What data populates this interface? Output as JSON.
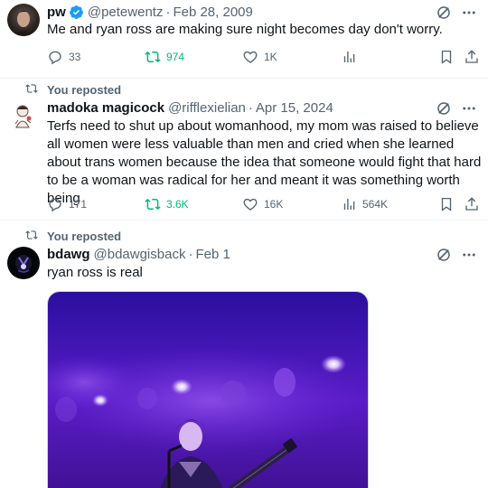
{
  "tweets": [
    {
      "name": "pw",
      "handle": "@petewentz",
      "date": "Feb 28, 2009",
      "verified": true,
      "text": "Me and ryan ross are making sure night becomes day don't worry.",
      "replies": "33",
      "reposts": "974",
      "likes": "1K",
      "views": ""
    },
    {
      "repost_label": "You reposted",
      "name": "madoka magicock",
      "handle": "@rifflexielian",
      "date": "Apr 15, 2024",
      "text": "Terfs need to shut up about womanhood, my mom was raised to believe all women were less valuable than men and cried when she learned about trans women because the idea that someone would fight that hard to be a woman was radical for her and meant it was something worth being",
      "replies": "171",
      "reposts": "3.6K",
      "likes": "16K",
      "views": "564K"
    },
    {
      "repost_label": "You reposted",
      "name": "bdawg",
      "handle": "@bdawgisback",
      "date": "Feb 1",
      "text": "ryan ross is real"
    }
  ],
  "separator": "·",
  "colors": {
    "text": "#0f1419",
    "muted": "#536471",
    "verified": "#1d9bf0",
    "repost_active": "#00ba7c",
    "divider": "#eff3f4"
  },
  "icons": {
    "grok": "grok-icon",
    "more": "more-icon",
    "reply": "reply-icon",
    "repost": "repost-icon",
    "like": "heart-icon",
    "views": "views-icon",
    "bookmark": "bookmark-icon",
    "share": "share-icon"
  }
}
